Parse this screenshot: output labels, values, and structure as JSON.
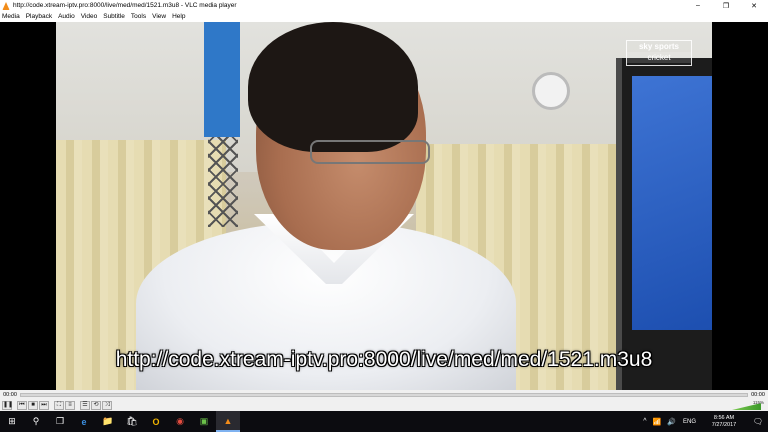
{
  "window": {
    "title": "http://code.xtream-iptv.pro:8000/live/med/med/1521.m3u8 - VLC media player",
    "minimize_glyph": "–",
    "maximize_glyph": "❐",
    "close_glyph": "✕"
  },
  "menu": [
    "Media",
    "Playback",
    "Audio",
    "Video",
    "Subtitle",
    "Tools",
    "View",
    "Help"
  ],
  "video": {
    "channel_logo_line1": "sky sports",
    "channel_logo_line2": "cricket",
    "subtitle": "http://code.xtream-iptv.pro:8000/live/med/med/1521.m3u8"
  },
  "seek": {
    "elapsed": "00:00",
    "total": "00:00",
    "position_fraction": 0.0
  },
  "controls": {
    "pause": "❚❚",
    "prev": "⏮",
    "stop": "■",
    "next": "⏭",
    "fullscreen": "⛶",
    "extended": "≡",
    "playlist": "☰",
    "loop": "⟲",
    "random": "⤨",
    "volume_label": "115%",
    "volume_fraction": 1.15
  },
  "taskbar": {
    "start": "⊞",
    "search": "⚲",
    "taskview": "❐",
    "edge": "e",
    "explorer": "📁",
    "store": "🛍",
    "outlook": "O",
    "chrome": "◉",
    "app": "▣",
    "vlc": "▲",
    "tray_up": "^",
    "tray_network": "📶",
    "tray_volume": "🔊",
    "language": "ENG",
    "time": "8:56 AM",
    "date": "7/27/2017",
    "notifications": "🗨"
  },
  "colors": {
    "taskbar_bg": "#0c0c10",
    "chrome_bg": "#f0f0f0",
    "accent": "#7fb2f0"
  }
}
